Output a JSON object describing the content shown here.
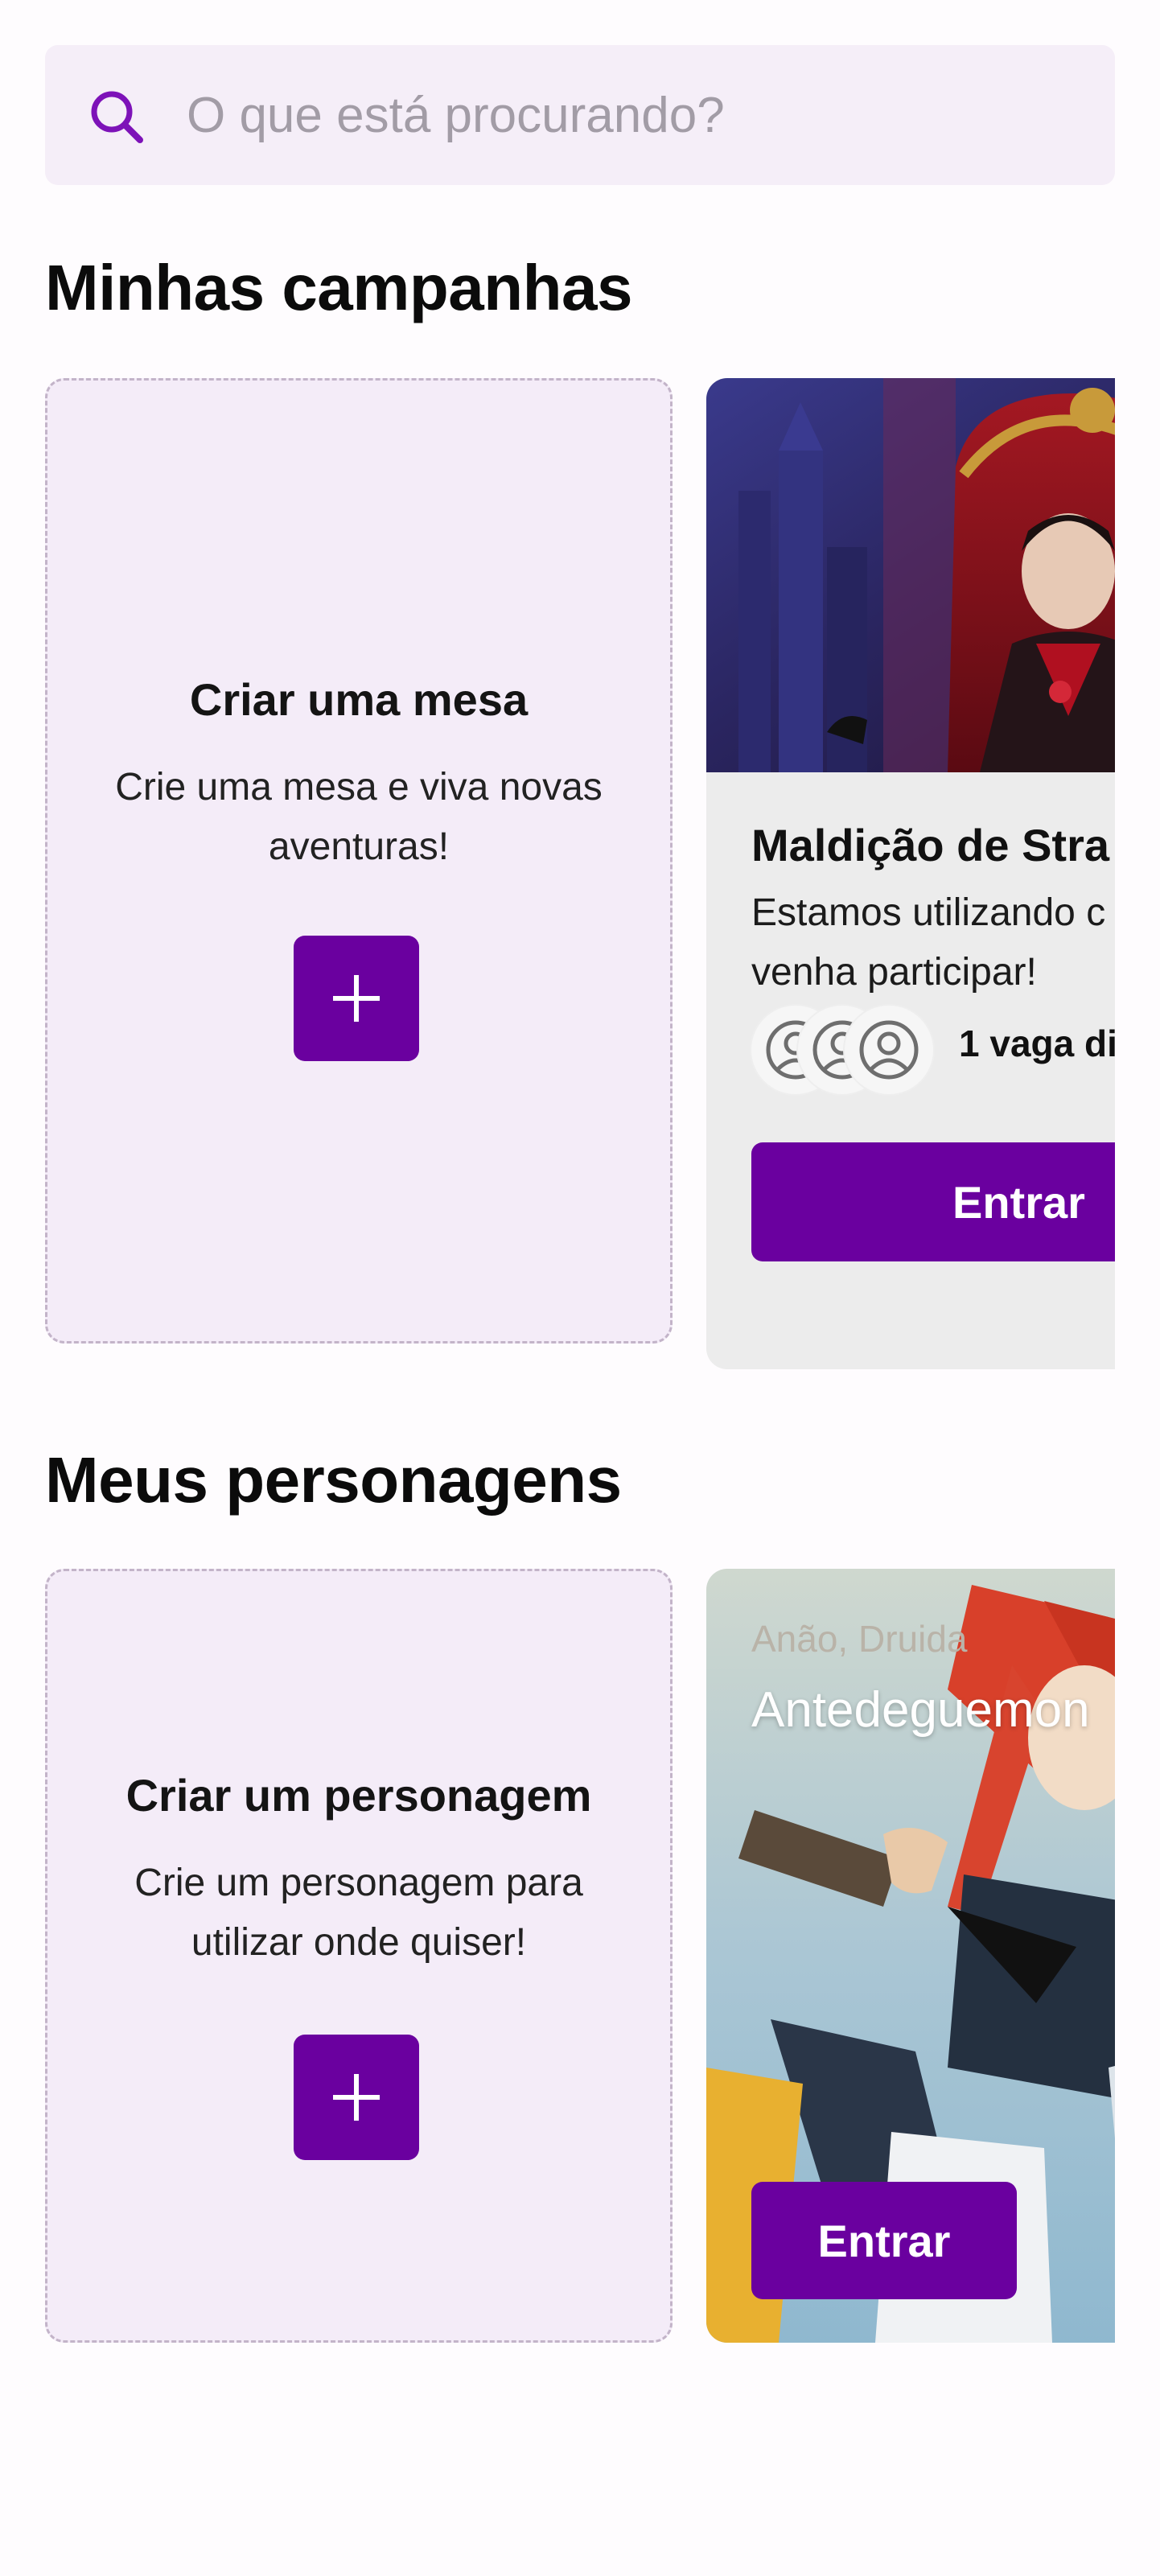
{
  "search": {
    "placeholder": "O que está procurando?"
  },
  "campaigns": {
    "title": "Minhas campanhas",
    "create_card": {
      "title": "Criar uma mesa",
      "description": "Crie uma mesa e viva novas aventuras!",
      "button_icon": "plus-icon"
    },
    "card": {
      "name": "Maldição de Stra",
      "description_lines": [
        "Estamos utilizando c",
        "venha participar!"
      ],
      "slots": "1 vaga di",
      "button_label": "Entrar"
    }
  },
  "characters": {
    "title": "Meus personagens",
    "create_card": {
      "title": "Criar um personagem",
      "description": "Crie um personagem para utilizar onde quiser!",
      "button_icon": "plus-icon"
    },
    "card": {
      "meta": "Anão, Druida",
      "name": "Antedeguemon",
      "button_label": "Entrar"
    }
  },
  "colors": {
    "accent": "#6a009f",
    "search_bg": "#f5eef8",
    "create_card_bg": "#f4ecf8",
    "card_bg": "#ececec"
  }
}
